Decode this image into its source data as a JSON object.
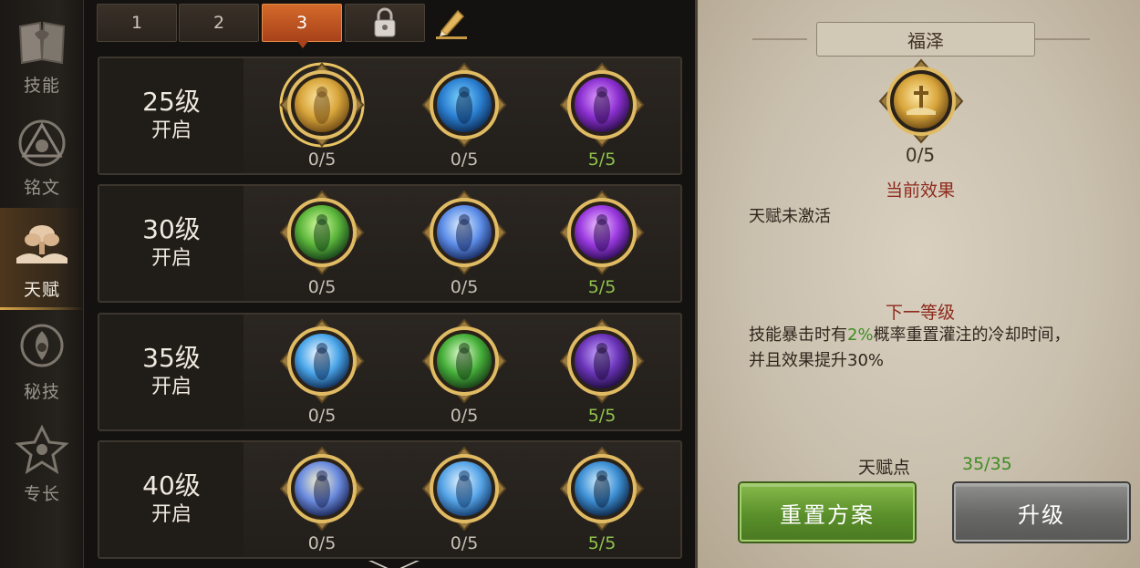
{
  "sidebar": {
    "items": [
      {
        "label": "技能",
        "icon": "skill-book-icon",
        "active": false
      },
      {
        "label": "铭文",
        "icon": "inscription-icon",
        "active": false
      },
      {
        "label": "天赋",
        "icon": "talent-tree-icon",
        "active": true
      },
      {
        "label": "秘技",
        "icon": "secret-art-icon",
        "active": false
      },
      {
        "label": "专长",
        "icon": "specialty-icon",
        "active": false
      }
    ]
  },
  "tabs": {
    "items": [
      {
        "label": "1",
        "active": false
      },
      {
        "label": "2",
        "active": false
      },
      {
        "label": "3",
        "active": true
      }
    ],
    "locked_tab_icon": "lock-icon",
    "edit_icon": "pencil-icon"
  },
  "rows": [
    {
      "level": "25级",
      "open": "开启",
      "talents": [
        {
          "count": "0/5",
          "icon": "holy-cross-icon",
          "selected": true
        },
        {
          "count": "0/5",
          "icon": "silhouette-icon"
        },
        {
          "count": "5/5",
          "icon": "shadow-hand-icon",
          "max": true
        }
      ]
    },
    {
      "level": "30级",
      "open": "开启",
      "talents": [
        {
          "count": "0/5",
          "icon": "green-figure-icon"
        },
        {
          "count": "0/5",
          "icon": "light-burst-icon"
        },
        {
          "count": "5/5",
          "icon": "purple-vortex-icon",
          "max": true
        }
      ]
    },
    {
      "level": "35级",
      "open": "开启",
      "talents": [
        {
          "count": "0/5",
          "icon": "lightning-strike-icon"
        },
        {
          "count": "0/5",
          "icon": "heal-cross-icon"
        },
        {
          "count": "5/5",
          "icon": "hooded-figure-icon",
          "max": true
        }
      ]
    },
    {
      "level": "40级",
      "open": "开启",
      "talents": [
        {
          "count": "0/5",
          "icon": "thunder-figure-icon"
        },
        {
          "count": "0/5",
          "icon": "winged-shield-icon"
        },
        {
          "count": "5/5",
          "icon": "spirit-figure-icon",
          "max": true
        }
      ]
    }
  ],
  "detail": {
    "title": "福泽",
    "icon": "holy-cross-icon",
    "count": "0/5",
    "current_effect_heading": "当前效果",
    "current_effect_text": "天赋未激活",
    "next_level_heading": "下一等级",
    "next_level_text_before": "技能暴击时有",
    "next_level_highlight": "2%",
    "next_level_text_after": "概率重置灌注的冷却时间，",
    "next_level_line2": "并且效果提升30%",
    "points_label": "天赋点",
    "points_value": "35/35"
  },
  "buttons": {
    "reset_label": "重置方案",
    "upgrade_label": "升级"
  },
  "colors": {
    "accent_orange": "#c4561f",
    "max_green": "#8ec34a",
    "heading_red": "#8e2a1c",
    "reset_green": "#5a8f2a",
    "upgrade_gray": "#676765"
  }
}
